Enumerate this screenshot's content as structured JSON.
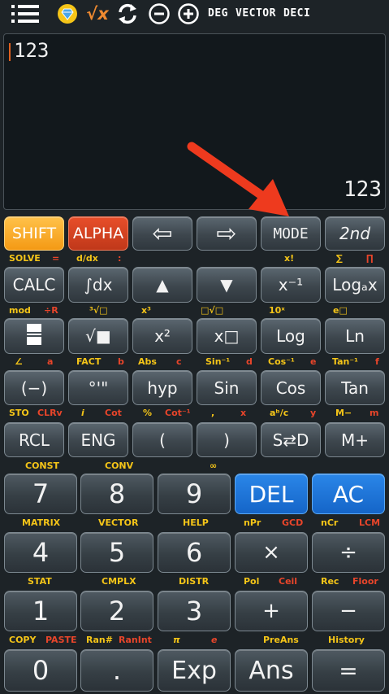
{
  "toolbar": {
    "menu_icon": "hamburger-menu-icon",
    "theme_icon": "diamond-icon",
    "sqrtx_label": "√x",
    "swap_icon": "refresh-arrows-icon",
    "minus_icon": "circle-minus-icon",
    "plus_icon": "circle-plus-icon",
    "angle_mode": "DEG",
    "calc_mode": "VECTOR",
    "number_mode": "DECI"
  },
  "display": {
    "expression": "123",
    "result": "123"
  },
  "rows": {
    "r1": {
      "shift": "SHIFT",
      "alpha": "ALPHA",
      "left": "⇦",
      "right": "⇨",
      "mode": "MODE",
      "second": "2nd",
      "subs": {
        "solve": "SOLVE",
        "eq": "=",
        "ddx": "d/dx",
        "colon": ":",
        "fact_x": "x!",
        "sigma": "∑",
        "pi": "∏"
      }
    },
    "r2": {
      "calc": "CALC",
      "integral": "∫dx",
      "up": "▲",
      "down": "▼",
      "inverse": "x⁻¹",
      "logax": "Logₐx",
      "subs": {
        "mod": "mod",
        "divr": "÷R",
        "cbrt": "³√□",
        "cube": "x³",
        "xroot": "□√□",
        "tenx": "10ˣ",
        "ex": "e□"
      }
    },
    "r3": {
      "fraction": "▀▄",
      "sqrt": "√■",
      "square": "x²",
      "power": "x□",
      "log": "Log",
      "ln": "Ln",
      "subs": {
        "angle": "∠",
        "a": "a",
        "fact": "FACT",
        "b": "b",
        "abs": "Abs",
        "c": "c",
        "asin": "Sin⁻¹",
        "d": "d",
        "acos": "Cos⁻¹",
        "e": "e",
        "atan": "Tan⁻¹",
        "f": "f"
      }
    },
    "r4": {
      "negative": "(−)",
      "dms": "°'\"",
      "hyp": "hyp",
      "sin": "Sin",
      "cos": "Cos",
      "tan": "Tan",
      "subs": {
        "sto": "STO",
        "clrv": "CLRv",
        "i": "i",
        "cot": "Cot",
        "pct": "%",
        "acot": "Cot⁻¹",
        "comma": ",",
        "x": "x",
        "abc": "aᵇ/c",
        "y": "y",
        "mminus": "M−",
        "m": "m"
      }
    },
    "r5": {
      "rcl": "RCL",
      "eng": "ENG",
      "lparen": "(",
      "rparen": ")",
      "sd": "S⇄D",
      "mplus": "M+",
      "subs": {
        "const": "CONST",
        "conv": "CONV",
        "inf": "∞"
      }
    },
    "r6": {
      "seven": "7",
      "eight": "8",
      "nine": "9",
      "del": "DEL",
      "ac": "AC",
      "subs": {
        "matrix": "MATRIX",
        "vector": "VECTOR",
        "help": "HELP",
        "npr": "nPr",
        "gcd": "GCD",
        "ncr": "nCr",
        "lcm": "LCM"
      }
    },
    "r7": {
      "four": "4",
      "five": "5",
      "six": "6",
      "times": "×",
      "divide": "÷",
      "subs": {
        "stat": "STAT",
        "cmplx": "CMPLX",
        "distr": "DISTR",
        "pol": "Pol",
        "ceil": "Ceil",
        "rec": "Rec",
        "floor": "Floor"
      }
    },
    "r8": {
      "one": "1",
      "two": "2",
      "three": "3",
      "plus": "+",
      "minus": "−",
      "subs": {
        "copy": "COPY",
        "paste": "PASTE",
        "ran": "Ran#",
        "ranint": "RanInt",
        "pi": "π",
        "e": "e",
        "preans": "PreAns",
        "history": "History"
      }
    },
    "r9": {
      "zero": "0",
      "dot": ".",
      "exp": "Exp",
      "ans": "Ans",
      "equals": "="
    }
  },
  "colors": {
    "background": "#1d2327",
    "shift": "#f49a14",
    "alpha": "#c0381a",
    "del_ac": "#1565c8",
    "secondary_yellow": "#f5c518",
    "secondary_red": "#e8452a",
    "annotation_arrow": "#ee3a1e"
  }
}
